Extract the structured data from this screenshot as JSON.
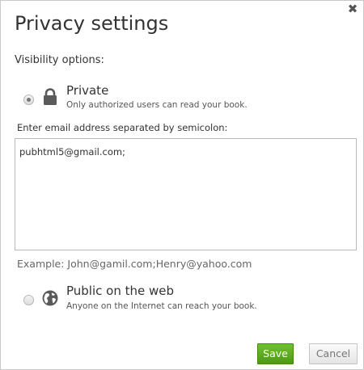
{
  "dialog": {
    "title": "Privacy settings",
    "close_label": "✖"
  },
  "visibility": {
    "label": "Visibility options:",
    "options": [
      {
        "title": "Private",
        "description": "Only authorized users can read your book.",
        "icon": "lock-icon",
        "selected": true
      },
      {
        "title": "Public on the web",
        "description": "Anyone on the Internet can reach your book.",
        "icon": "globe-icon",
        "selected": false
      }
    ]
  },
  "email": {
    "label": "Enter email address separated by semicolon:",
    "value": "pubhtml5@gmail.com;",
    "example": "Example: John@gamil.com;Henry@yahoo.com"
  },
  "buttons": {
    "save": "Save",
    "cancel": "Cancel"
  },
  "colors": {
    "save_button": "#5aab1f",
    "border": "#c9c9c9",
    "text": "#333333"
  }
}
